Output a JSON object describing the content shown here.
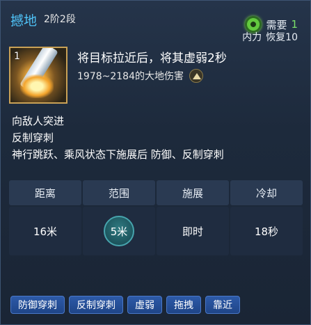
{
  "skill": {
    "name": "撼地",
    "rank": "2阶2段",
    "icon_number": "1"
  },
  "requirement": {
    "label": "需要",
    "value": "1",
    "icon": "swirl-icon",
    "mana_label": "内力",
    "mana_value": "恢复10"
  },
  "description": {
    "main": "将目标拉近后，将其虚弱2秒",
    "damage": "1978~2184的大地伤害",
    "damage_icon": "earth-element-icon",
    "lines": [
      "向敌人突进",
      "反制穿刺",
      "神行跳跃、乘风状态下施展后 防御、反制穿刺"
    ]
  },
  "stats": {
    "headers": [
      "距离",
      "范围",
      "施展",
      "冷却"
    ],
    "values": [
      "16米",
      "5米",
      "即时",
      "18秒"
    ]
  },
  "tags": [
    "防御穿刺",
    "反制穿刺",
    "虚弱",
    "拖拽",
    "靠近"
  ],
  "colors": {
    "name": "#4fc3f7",
    "requirement_value": "#7be06a",
    "tag_bg": "#1f4588",
    "panel_bg": "#1d2a3c"
  }
}
